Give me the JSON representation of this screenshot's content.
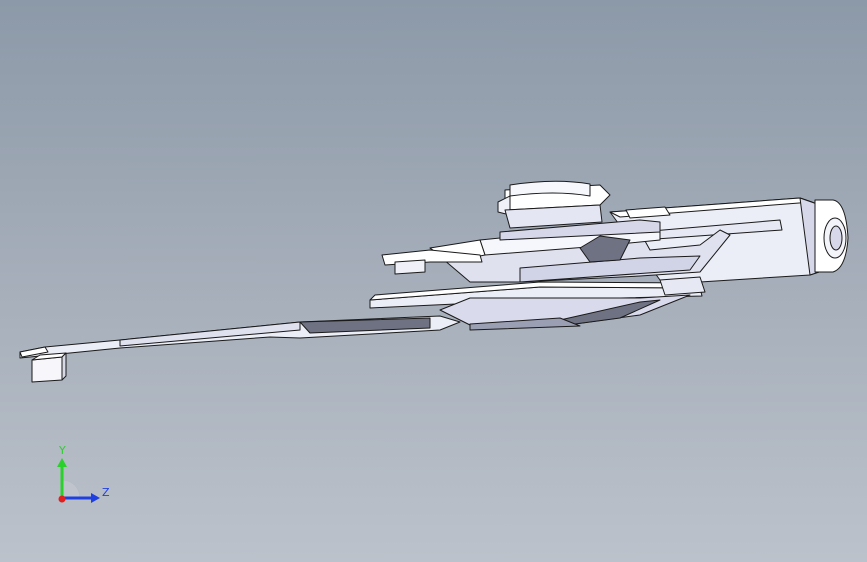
{
  "viewport": {
    "background_top": "#8c99a8",
    "background_bottom": "#bcc2cb",
    "model_fill": "#eceef7",
    "model_shade": "#d4d6ea",
    "model_edge": "#1a1a1a"
  },
  "triad": {
    "y_label": "Y",
    "z_label": "Z",
    "y_color": "#2bd12b",
    "z_color": "#1f3fe0",
    "x_color": "#e01f1f"
  }
}
